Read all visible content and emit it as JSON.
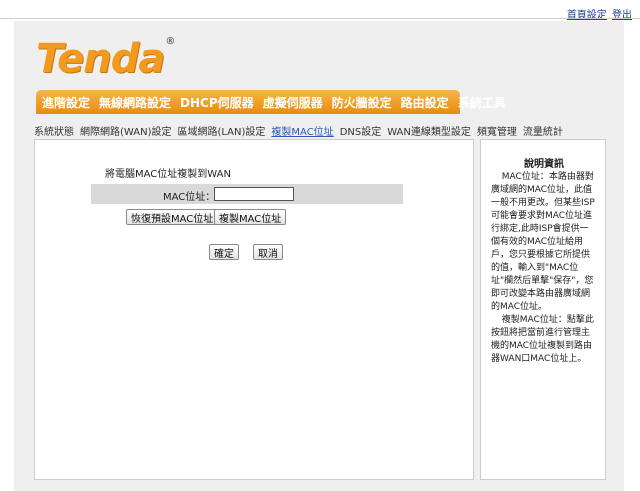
{
  "top_links": {
    "home": "首頁設定",
    "logout": "登出"
  },
  "brand": {
    "logo_text": "Tenda",
    "logo_mark": "®",
    "color": "#f19a1d"
  },
  "main_nav": [
    "進階設定",
    "無線網路設定",
    "DHCP伺服器",
    "虛擬伺服器",
    "防火牆設定",
    "路由設定",
    "系統工具"
  ],
  "sub_nav": [
    {
      "label": "系統狀態",
      "active": false
    },
    {
      "label": "網際網路(WAN)設定",
      "active": false
    },
    {
      "label": "區域網路(LAN)設定",
      "active": false
    },
    {
      "label": "複製MAC位址",
      "active": true
    },
    {
      "label": "DNS設定",
      "active": false
    },
    {
      "label": "WAN連線類型設定",
      "active": false
    },
    {
      "label": "頻寬管理",
      "active": false
    },
    {
      "label": "流量統計",
      "active": false
    }
  ],
  "form": {
    "section_title": "將電腦MAC位址複製到WAN",
    "mac_label": "MAC位址：",
    "mac_value": "",
    "restore_default_button": "恢復預設MAC位址",
    "clone_button": "複製MAC位址",
    "ok_button": "確定",
    "cancel_button": "取消"
  },
  "help": {
    "title": "說明資訊",
    "para1": "MAC位址：本路由器對廣域網的MAC位址，此值一般不用更改。但某些ISP可能會要求對MAC位址進行綁定,此時ISP會提供一個有效的MAC位址給用戶，您只要根據它所提供的值，輸入到\"MAC位址\"欄然后單擊\"保存\"，您即可改變本路由器廣域網的MAC位址。",
    "para2": "複製MAC位址：點擊此按鈕將把當前進行管理主機的MAC位址複製到路由器WAN口MAC位址上。"
  },
  "colors": {
    "accent": "#e88c10",
    "link": "#2d59b7",
    "background": "#efefef"
  }
}
